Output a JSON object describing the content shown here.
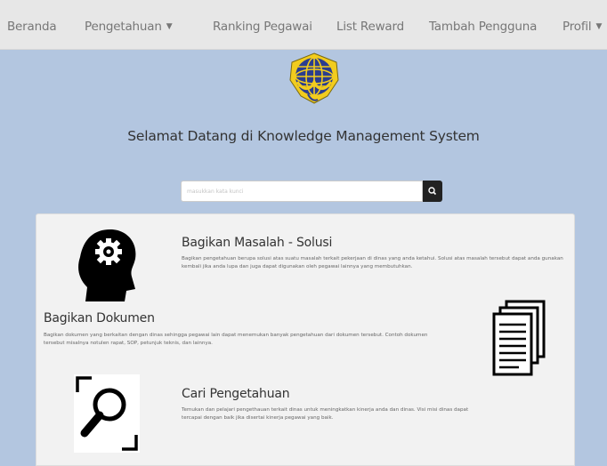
{
  "navbar": {
    "items": [
      {
        "label": "Beranda",
        "dropdown": false
      },
      {
        "label": "Pengetahuan",
        "dropdown": true
      },
      {
        "label": "Ranking Pegawai",
        "dropdown": false
      },
      {
        "label": "List Reward",
        "dropdown": false
      },
      {
        "label": "Tambah Pengguna",
        "dropdown": false
      },
      {
        "label": "Profil",
        "dropdown": true
      }
    ],
    "caret_glyph": "▼"
  },
  "hero": {
    "logo_icon": "ministry-emblem-icon",
    "welcome_text": "Selamat Datang di Knowledge Management System"
  },
  "search": {
    "placeholder": "masukkan kata kunci",
    "value": "",
    "button_icon": "search-icon"
  },
  "features": [
    {
      "title": "Bagikan Masalah - Solusi",
      "description": "Bagikan pengetahuan berupa solusi atas suatu masalah terkait pekerjaan di dinas yang anda ketahui. Solusi atas masalah tersebut dapat anda gunakan kembali jika anda lupa dan juga dapat digunakan oleh pegawai lainnya yang membutuhkan.",
      "icon": "head-gear-icon"
    },
    {
      "title": "Bagikan Dokumen",
      "description": "Bagikan dokumen yang berkaitan dengan dinas sehingga pegawai lain dapat menemukan banyak pengetahuan dari dokumen tersebut. Contoh dokumen tersebut misalnya notulen rapat, SOP, petunjuk teknis, dan lainnya.",
      "icon": "documents-icon"
    },
    {
      "title": "Cari Pengetahuan",
      "description": "Temukan dan pelajari pengethauan terkait dinas untuk meningkatkan kinerja anda dan dinas. Visi misi dinas dapat tercapai dengan baik jika disertai kinerja pegawai yang baik.",
      "icon": "magnifier-icon"
    }
  ],
  "colors": {
    "navbar_bg": "#e7e7e7",
    "page_bg": "#b3c6e0",
    "panel_bg": "#f2f2f2",
    "logo_blue": "#2b3d8f",
    "logo_yellow": "#f2cc1d"
  }
}
